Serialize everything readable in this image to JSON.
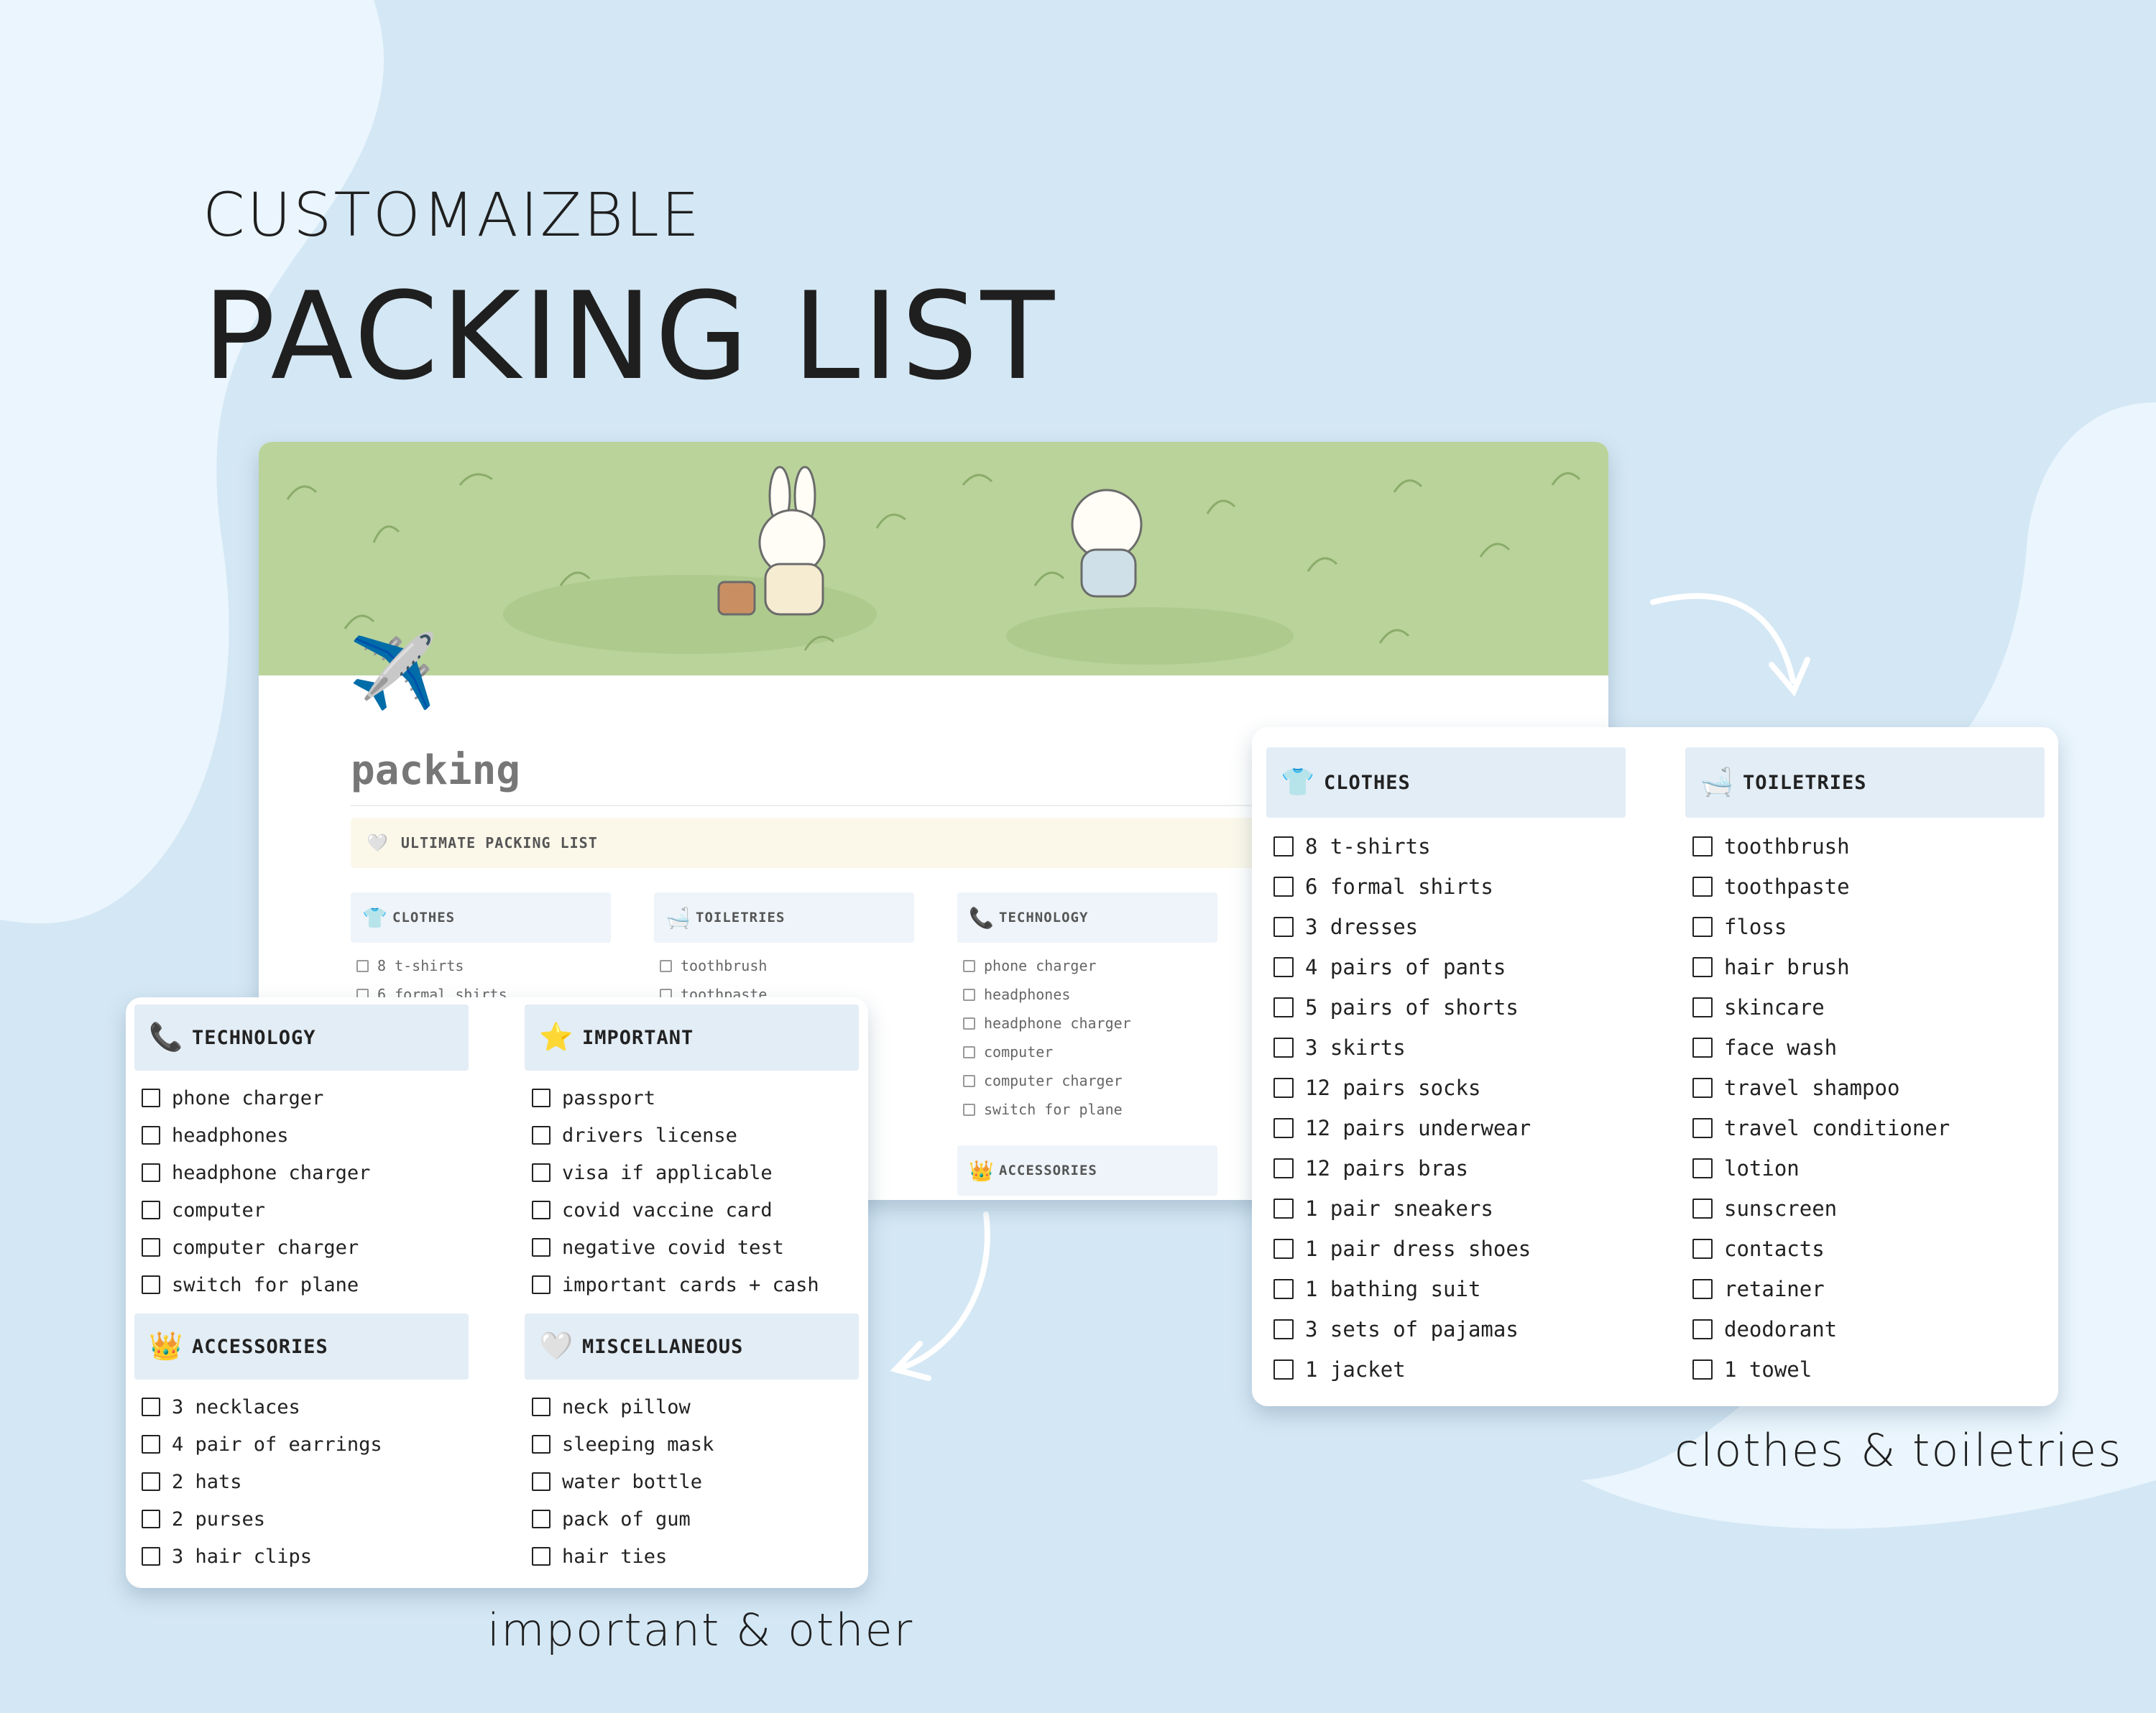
{
  "headline": {
    "subtitle": "CUSTOMAIZBLE",
    "title": "PACKING LIST"
  },
  "colors": {
    "background": "#d4e7f4",
    "blob": "#eaf5fd",
    "header_fill": "#e3edf6",
    "callout_fill": "#fbf8ea",
    "cover_grass": "#b9d39a"
  },
  "page": {
    "icon": "airplane-icon",
    "icon_glyph": "✈️",
    "title": "packing",
    "callout": {
      "icon": "heart-icon",
      "icon_glyph": "🤍",
      "text": "ULTIMATE PACKING LIST"
    },
    "columns": [
      {
        "icon": "shirt-icon",
        "icon_glyph": "👕",
        "title": "CLOTHES",
        "items": [
          "8 t-shirts",
          "6 formal shirts"
        ]
      },
      {
        "icon": "bathtub-icon",
        "icon_glyph": "🛁",
        "title": "TOILETRIES",
        "items": [
          "toothbrush",
          "toothpaste"
        ]
      },
      {
        "icon": "phone-icon",
        "icon_glyph": "📞",
        "title": "TECHNOLOGY",
        "items": [
          "phone charger",
          "headphones",
          "headphone charger",
          "computer",
          "computer charger",
          "switch for plane"
        ]
      }
    ],
    "accessories": {
      "icon": "crown-icon",
      "icon_glyph": "👑",
      "title": "ACCESSORIES"
    }
  },
  "left_card": {
    "sections": [
      {
        "icon": "phone-icon",
        "icon_glyph": "📞",
        "title": "TECHNOLOGY",
        "items": [
          "phone charger",
          "headphones",
          "headphone charger",
          "computer",
          "computer charger",
          "switch for plane"
        ]
      },
      {
        "icon": "star-icon",
        "icon_glyph": "⭐",
        "title": "IMPORTANT",
        "items": [
          "passport",
          "drivers license",
          "visa if applicable",
          "covid vaccine card",
          "negative covid test",
          "important cards + cash"
        ]
      },
      {
        "icon": "crown-icon",
        "icon_glyph": "👑",
        "title": "ACCESSORIES",
        "items": [
          "3 necklaces",
          "4 pair of earrings",
          "2 hats",
          "2 purses",
          "3 hair clips"
        ]
      },
      {
        "icon": "heart-icon",
        "icon_glyph": "🤍",
        "title": "MISCELLANEOUS",
        "items": [
          "neck pillow",
          "sleeping mask",
          "water bottle",
          "pack of gum",
          "hair ties"
        ]
      }
    ]
  },
  "right_card": {
    "sections": [
      {
        "icon": "shirt-icon",
        "icon_glyph": "👕",
        "title": "CLOTHES",
        "items": [
          "8 t-shirts",
          "6 formal shirts",
          "3 dresses",
          "4 pairs of pants",
          "5 pairs of shorts",
          "3 skirts",
          "12 pairs socks",
          "12 pairs underwear",
          "12 pairs bras",
          "1 pair sneakers",
          "1 pair dress shoes",
          "1 bathing suit",
          "3 sets of pajamas",
          "1 jacket"
        ]
      },
      {
        "icon": "bathtub-icon",
        "icon_glyph": "🛁",
        "title": "TOILETRIES",
        "items": [
          "toothbrush",
          "toothpaste",
          "floss",
          "hair brush",
          "skincare",
          "face wash",
          "travel shampoo",
          "travel conditioner",
          "lotion",
          "sunscreen",
          "contacts",
          "retainer",
          "deodorant",
          "1 towel"
        ]
      }
    ]
  },
  "captions": {
    "right": "clothes & toiletries",
    "left": "important & other"
  }
}
